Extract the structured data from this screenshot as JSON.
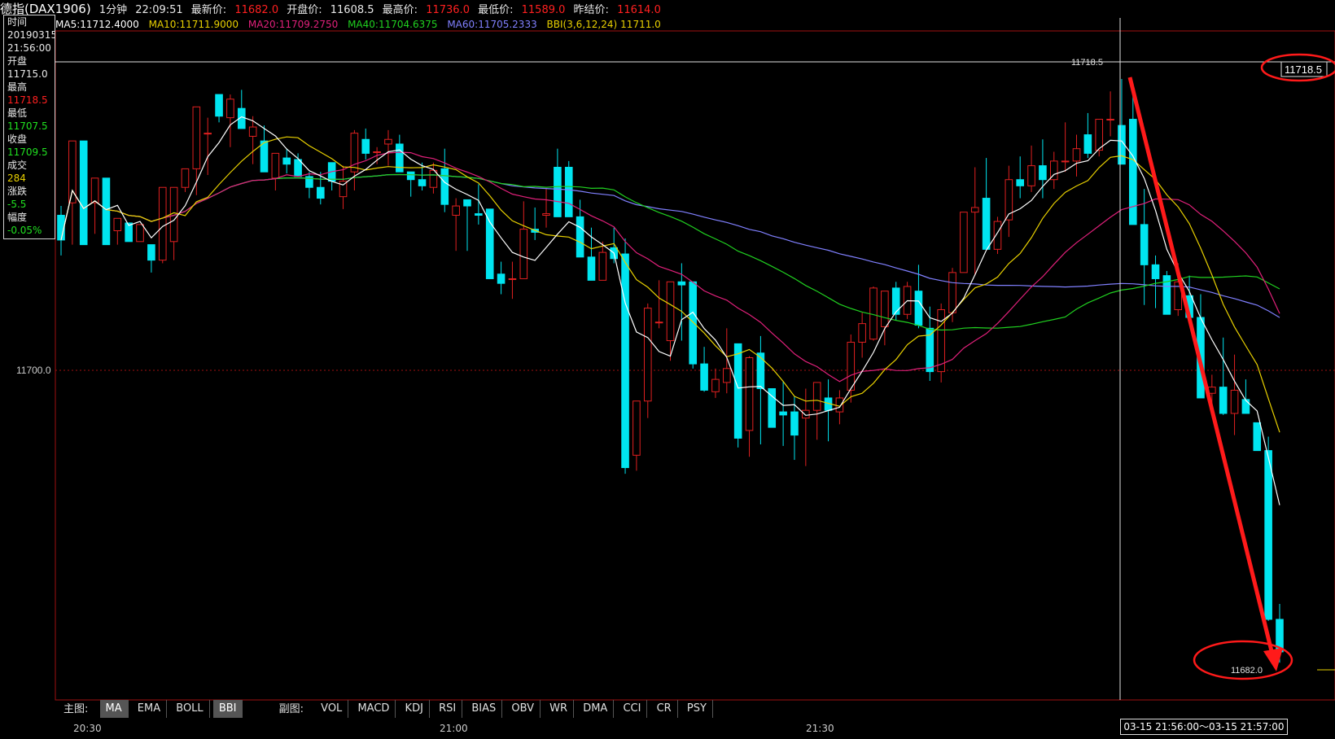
{
  "header": {
    "title": "德指(DAX1906)",
    "period": "1分钟",
    "time": "22:09:51",
    "last_label": "最新价:",
    "last_value": "11682.0",
    "open_label": "开盘价:",
    "open_value": "11608.5",
    "high_label": "最高价:",
    "high_value": "11736.0",
    "low_label": "最低价:",
    "low_value": "11589.0",
    "prev_label": "昨结价:",
    "prev_value": "11614.0"
  },
  "indicators": {
    "ma5": "MA5:11712.4000",
    "ma10": "MA10:11711.9000",
    "ma20": "MA20:11709.2750",
    "ma40": "MA40:11704.6375",
    "ma60": "MA60:11705.2333",
    "bbi": "BBI(3,6,12,24)",
    "bbi_value": "11711.0"
  },
  "info_panel": {
    "time_label": "时间",
    "date": "20190315",
    "time": "21:56:00",
    "open_label": "开盘",
    "open": "11715.0",
    "high_label": "最高",
    "high": "11718.5",
    "low_label": "最低",
    "low": "11707.5",
    "close_label": "收盘",
    "close": "11709.5",
    "volume_label": "成交",
    "volume": "284",
    "change_label": "涨跌",
    "change": "-5.5",
    "pct_label": "幅度",
    "pct": "-0.05%"
  },
  "price_axis": {
    "level_label": "11700.0",
    "crosshair_price": "11718.5",
    "crosshair_left_label": "11718.5",
    "last_price_label": "11682.0"
  },
  "main_tabs": {
    "label": "主图:",
    "items": [
      "MA",
      "EMA",
      "BOLL",
      "BBI"
    ],
    "selected": [
      "MA",
      "BBI"
    ]
  },
  "sub_tabs": {
    "label": "副图:",
    "items": [
      "VOL",
      "MACD",
      "KDJ",
      "RSI",
      "BIAS",
      "OBV",
      "WR",
      "DMA",
      "CCI",
      "CR",
      "PSY"
    ]
  },
  "time_axis": [
    "20:30",
    "21:00",
    "21:30"
  ],
  "range_label": "03-15  21:56:00～03-15  21:57:00",
  "colors": {
    "up": "#e02020",
    "down": "#00e5f0",
    "ma5": "#ffffff",
    "ma10": "#e8d000",
    "ma20": "#e0207a",
    "ma40": "#20d020",
    "ma60": "#8080ff",
    "annotation": "#ff1a1a"
  },
  "chart_data": {
    "type": "candlestick",
    "ylim": [
      11679,
      11722
    ],
    "candles_ohlc": [
      [
        11710.2,
        11710.8,
        11707.6,
        11708.6
      ],
      [
        11711.0,
        11715.0,
        11708.3,
        11715.0
      ],
      [
        11715.0,
        11715.0,
        11708.3,
        11708.3
      ],
      [
        11711.0,
        11712.6,
        11709.0,
        11712.6
      ],
      [
        11712.6,
        11712.6,
        11708.3,
        11708.3
      ],
      [
        11709.2,
        11710.0,
        11708.3,
        11710.0
      ],
      [
        11709.7,
        11709.7,
        11708.5,
        11708.5
      ],
      [
        11708.5,
        11709.6,
        11708.5,
        11709.6
      ],
      [
        11708.3,
        11708.3,
        11706.5,
        11707.3
      ],
      [
        11707.3,
        11712.0,
        11707.1,
        11712.0
      ],
      [
        11708.5,
        11712.0,
        11707.3,
        11712.0
      ],
      [
        11712.0,
        11713.2,
        11711.7,
        11713.2
      ],
      [
        11713.2,
        11717.2,
        11711.5,
        11717.2
      ],
      [
        11715.5,
        11716.5,
        11712.8,
        11715.5
      ],
      [
        11718.0,
        11718.0,
        11716.2,
        11716.6
      ],
      [
        11716.5,
        11718.0,
        11714.6,
        11717.7
      ],
      [
        11717.1,
        11718.3,
        11715.8,
        11715.8
      ],
      [
        11715.3,
        11716.6,
        11713.5,
        11715.9
      ],
      [
        11715.0,
        11716.0,
        11713.0,
        11713.0
      ],
      [
        11712.6,
        11714.2,
        11711.8,
        11714.2
      ],
      [
        11713.9,
        11714.5,
        11712.9,
        11713.5
      ],
      [
        11713.8,
        11714.2,
        11712.8,
        11712.7
      ],
      [
        11712.7,
        11713.0,
        11711.3,
        11712.0
      ],
      [
        11712.0,
        11713.0,
        11710.9,
        11711.3
      ],
      [
        11713.6,
        11713.6,
        11711.8,
        11712.4
      ],
      [
        11711.4,
        11713.4,
        11710.6,
        11712.4
      ],
      [
        11713.0,
        11715.7,
        11711.8,
        11715.5
      ],
      [
        11715.1,
        11715.8,
        11713.8,
        11714.2
      ],
      [
        11714.3,
        11714.6,
        11713.5,
        11714.3
      ],
      [
        11714.8,
        11715.7,
        11713.4,
        11715.1
      ],
      [
        11714.8,
        11715.4,
        11713.0,
        11713.0
      ],
      [
        11713.0,
        11713.0,
        11711.4,
        11712.5
      ],
      [
        11712.5,
        11713.6,
        11711.8,
        11712.1
      ],
      [
        11712.0,
        11713.6,
        11711.6,
        11713.1
      ],
      [
        11713.2,
        11714.5,
        11710.4,
        11710.9
      ],
      [
        11710.2,
        11711.3,
        11707.9,
        11710.8
      ],
      [
        11711.2,
        11711.2,
        11707.9,
        11710.8
      ],
      [
        11710.3,
        11712.2,
        11709.6,
        11710.2
      ],
      [
        11710.6,
        11710.6,
        11706.4,
        11706.1
      ],
      [
        11706.4,
        11707.2,
        11705.1,
        11705.8
      ],
      [
        11706.1,
        11707.2,
        11704.8,
        11706.1
      ],
      [
        11706.1,
        11711.1,
        11706.1,
        11709.3
      ],
      [
        11709.3,
        11710.7,
        11708.6,
        11709.1
      ],
      [
        11710.2,
        11711.9,
        11709.4,
        11710.3
      ],
      [
        11713.3,
        11714.5,
        11710.9,
        11710.1
      ],
      [
        11713.3,
        11713.7,
        11710.9,
        11710.1
      ],
      [
        11710.1,
        11711.2,
        11707.7,
        11707.5
      ],
      [
        11707.5,
        11709.4,
        11707.2,
        11706.0
      ],
      [
        11706.0,
        11708.5,
        11706.0,
        11707.8
      ],
      [
        11708.1,
        11709.4,
        11707.1,
        11707.4
      ],
      [
        11707.7,
        11708.7,
        11693.5,
        11693.9
      ],
      [
        11694.7,
        11697.1,
        11693.7,
        11698.2
      ],
      [
        11698.2,
        11704.5,
        11697.1,
        11704.2
      ],
      [
        11703.3,
        11706.0,
        11702.9,
        11703.3
      ],
      [
        11702.1,
        11705.5,
        11700.8,
        11705.9
      ],
      [
        11705.9,
        11707.1,
        11702.1,
        11705.7
      ],
      [
        11705.9,
        11705.9,
        11700.3,
        11700.6
      ],
      [
        11700.6,
        11701.7,
        11698.8,
        11698.9
      ],
      [
        11698.8,
        11700.3,
        11698.4,
        11699.6
      ],
      [
        11699.4,
        11702.9,
        11698.7,
        11700.3
      ],
      [
        11701.9,
        11701.9,
        11695.2,
        11695.8
      ],
      [
        11696.3,
        11701.1,
        11694.6,
        11701.0
      ],
      [
        11701.3,
        11702.4,
        11695.4,
        11699.0
      ],
      [
        11699.0,
        11699.0,
        11697.3,
        11696.5
      ],
      [
        11697.5,
        11699.5,
        11695.3,
        11697.3
      ],
      [
        11697.5,
        11698.5,
        11694.4,
        11696.0
      ],
      [
        11697.1,
        11699.0,
        11694.0,
        11697.6
      ],
      [
        11697.6,
        11698.0,
        11695.7,
        11699.4
      ],
      [
        11698.4,
        11699.6,
        11695.6,
        11697.6
      ],
      [
        11697.5,
        11698.9,
        11696.7,
        11698.4
      ],
      [
        11698.9,
        11702.5,
        11698.1,
        11702.0
      ],
      [
        11702.0,
        11703.9,
        11701.0,
        11703.2
      ],
      [
        11702.2,
        11705.6,
        11702.1,
        11705.5
      ],
      [
        11703.0,
        11705.2,
        11701.8,
        11705.3
      ],
      [
        11705.5,
        11705.9,
        11703.4,
        11703.8
      ],
      [
        11703.8,
        11705.9,
        11703.5,
        11705.6
      ],
      [
        11705.3,
        11707.0,
        11702.9,
        11703.1
      ],
      [
        11702.9,
        11704.3,
        11699.5,
        11700.1
      ],
      [
        11700.1,
        11704.5,
        11699.4,
        11704.1
      ],
      [
        11703.9,
        11706.8,
        11703.3,
        11706.5
      ],
      [
        11706.5,
        11710.4,
        11706.5,
        11710.4
      ],
      [
        11710.4,
        11713.3,
        11706.3,
        11710.7
      ],
      [
        11711.3,
        11713.9,
        11710.8,
        11708.0
      ],
      [
        11708.0,
        11710.1,
        11707.7,
        11709.8
      ],
      [
        11709.9,
        11713.4,
        11708.8,
        11712.5
      ],
      [
        11712.5,
        11714.0,
        11711.3,
        11712.1
      ],
      [
        11712.1,
        11714.7,
        11711.7,
        11713.4
      ],
      [
        11713.4,
        11715.1,
        11711.3,
        11712.5
      ],
      [
        11712.5,
        11714.3,
        11711.9,
        11713.7
      ],
      [
        11713.7,
        11716.2,
        11713.0,
        11713.7
      ],
      [
        11713.7,
        11715.4,
        11712.7,
        11714.5
      ],
      [
        11715.4,
        11716.8,
        11713.9,
        11714.2
      ],
      [
        11714.4,
        11716.4,
        11714.0,
        11716.4
      ],
      [
        11716.4,
        11718.2,
        11715.3,
        11716.4
      ],
      [
        11716.0,
        11719.0,
        11715.2,
        11713.5
      ],
      [
        11716.4,
        11718.5,
        11711.9,
        11709.6
      ],
      [
        11709.6,
        11711.9,
        11704.4,
        11707.0
      ],
      [
        11707.0,
        11707.6,
        11704.2,
        11706.1
      ],
      [
        11706.3,
        11706.6,
        11704.0,
        11703.8
      ],
      [
        11704.1,
        11707.1,
        11703.7,
        11705.9
      ],
      [
        11705.0,
        11706.3,
        11703.3,
        11703.6
      ],
      [
        11703.6,
        11705.1,
        11698.4,
        11698.4
      ],
      [
        11698.7,
        11699.9,
        11697.8,
        11699.1
      ],
      [
        11699.1,
        11702.3,
        11697.3,
        11697.4
      ],
      [
        11697.4,
        11701.2,
        11696.0,
        11698.9
      ],
      [
        11698.3,
        11699.6,
        11698.0,
        11697.4
      ],
      [
        11696.8,
        11696.8,
        11695.0,
        11695.0
      ],
      [
        11695.0,
        11695.9,
        11684.0,
        11684.1
      ],
      [
        11684.1,
        11685.1,
        11681.3,
        11682.0
      ]
    ]
  }
}
